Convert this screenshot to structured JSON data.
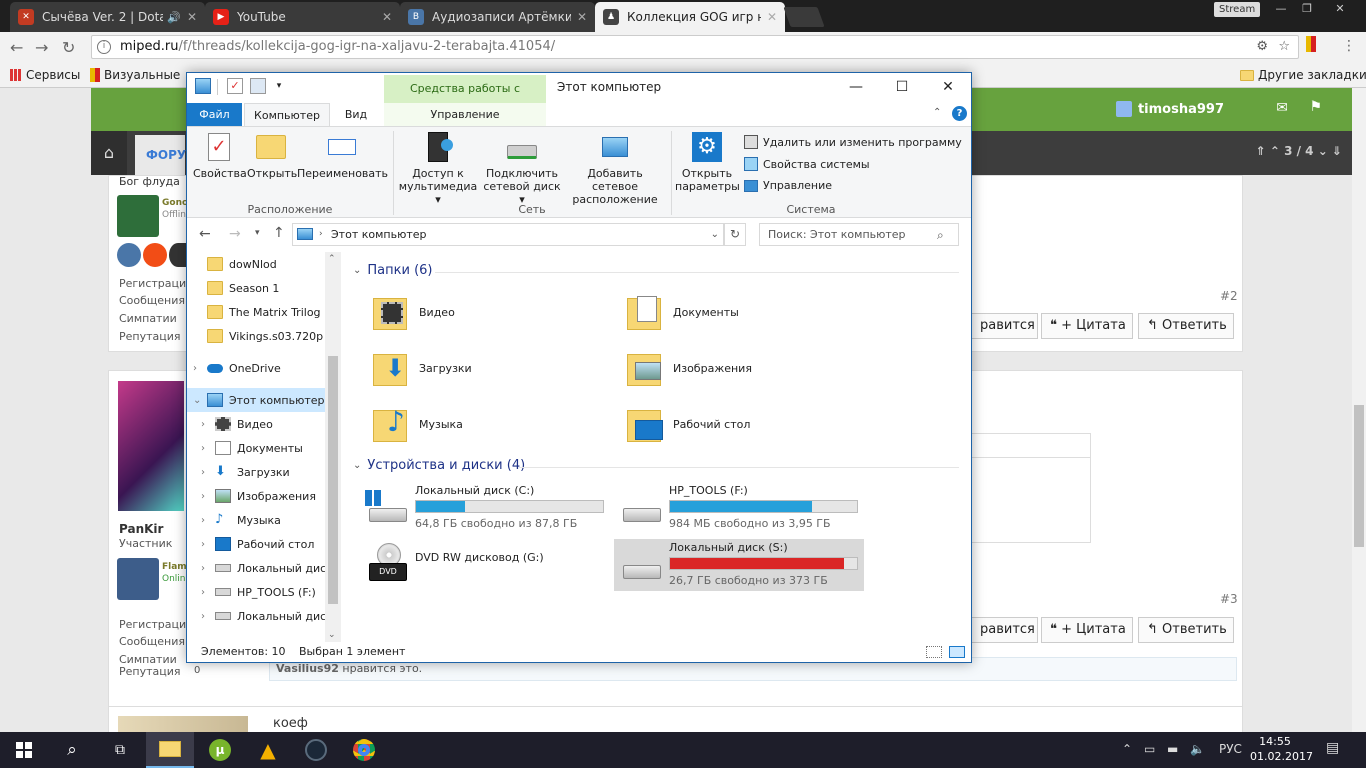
{
  "chrome": {
    "tabs": [
      {
        "title": "Сычёва Ver. 2 | Dota",
        "favicon_color": "#c23b22"
      },
      {
        "title": "YouTube",
        "favicon_color": "#e62117"
      },
      {
        "title": "Аудиозаписи Артёмки Г",
        "favicon_color": "#4a76a8"
      },
      {
        "title": "Коллекция GOG игр на",
        "favicon_color": "#444444"
      }
    ],
    "stream_badge": "Stream",
    "url_domain": "miped.ru",
    "url_path": "/f/threads/kollekcija-gog-igr-na-xaljavu-2-terabajta.41054/",
    "bookmarks_left_1": "Сервисы",
    "bookmarks_left_2": "Визуальные",
    "bookmarks_right": "Другие закладки"
  },
  "site": {
    "user": "timosha997",
    "forum_tab": "ФОРУ",
    "pager": "3 / 4",
    "post1": {
      "rank": "Бог флуда",
      "name": "Gono",
      "status": "Offlin",
      "num": "#2"
    },
    "post2": {
      "name": "PanKir",
      "role": "Участник",
      "author2": "Flam",
      "status2": "Onlin",
      "num": "#3",
      "reactions": "Vasilius92",
      "reactions_suffix": "нравится это.",
      "text": "коеф"
    },
    "labels": {
      "reg": "Регистрация",
      "msgs": "Сообщения",
      "likes": "Симпатии",
      "rep": "Репутация",
      "rep_val": "0"
    },
    "like_btn": "равится",
    "quote_btn": "+ Цитата",
    "reply_btn": "Ответить"
  },
  "explorer": {
    "contextual_tab": "Средства работы с дисками",
    "title": "Этот компьютер",
    "tabs": {
      "file": "Файл",
      "computer": "Компьютер",
      "view": "Вид",
      "manage": "Управление"
    },
    "ribbon": {
      "properties": "Свойства",
      "open": "Открыть",
      "rename": "Переименовать",
      "group_location": "Расположение",
      "media_access_1": "Доступ к",
      "media_access_2": "мультимедиа",
      "map_drive_1": "Подключить",
      "map_drive_2": "сетевой диск",
      "add_net_1": "Добавить сетевое",
      "add_net_2": "расположение",
      "group_network": "Сеть",
      "open_settings_1": "Открыть",
      "open_settings_2": "параметры",
      "uninstall": "Удалить или изменить программу",
      "sys_props": "Свойства системы",
      "manage": "Управление",
      "group_system": "Система"
    },
    "address": "Этот компьютер",
    "search_placeholder": "Поиск: Этот компьютер",
    "nav": [
      {
        "label": "dowNlod"
      },
      {
        "label": "Season 1"
      },
      {
        "label": "The Matrix Trilog"
      },
      {
        "label": "Vikings.s03.720p"
      },
      {
        "label": "OneDrive"
      },
      {
        "label": "Этот компьютер"
      },
      {
        "label": "Видео"
      },
      {
        "label": "Документы"
      },
      {
        "label": "Загрузки"
      },
      {
        "label": "Изображения"
      },
      {
        "label": "Музыка"
      },
      {
        "label": "Рабочий стол"
      },
      {
        "label": "Локальный дис"
      },
      {
        "label": "HP_TOOLS (F:)"
      },
      {
        "label": "Локальный дис"
      }
    ],
    "folders_header": "Папки (6)",
    "folders": [
      {
        "name": "Видео"
      },
      {
        "name": "Документы"
      },
      {
        "name": "Загрузки"
      },
      {
        "name": "Изображения"
      },
      {
        "name": "Музыка"
      },
      {
        "name": "Рабочий стол"
      }
    ],
    "devices_header": "Устройства и диски (4)",
    "drives": [
      {
        "name": "Локальный диск (C:)",
        "free": "64,8 ГБ свободно из 87,8 ГБ",
        "used_fraction": 0.26,
        "color": "#26a0da"
      },
      {
        "name": "HP_TOOLS (F:)",
        "free": "984 МБ свободно из 3,95 ГБ",
        "used_fraction": 0.76,
        "color": "#26a0da"
      },
      {
        "name": "DVD RW дисковод (G:)"
      },
      {
        "name": "Локальный диск (S:)",
        "free": "26,7 ГБ свободно из 373 ГБ",
        "used_fraction": 0.93,
        "color": "#da2626"
      }
    ],
    "status_items": "Элементов: 10",
    "status_selected": "Выбран 1 элемент"
  },
  "taskbar": {
    "lang": "РУС",
    "time": "14:55",
    "date": "01.02.2017"
  }
}
